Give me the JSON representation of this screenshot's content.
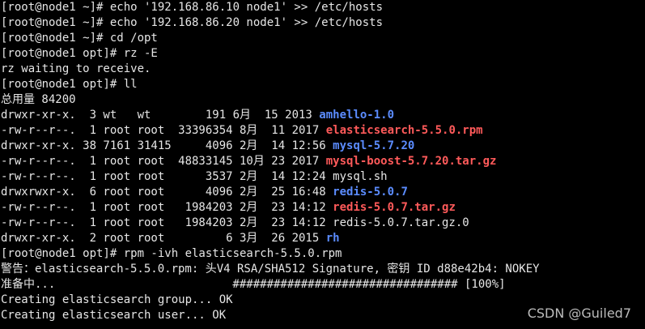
{
  "terminal": {
    "lines": [
      [
        {
          "text": "[root@node1 ~]# echo '192.168.86.10 node1' >> /etc/hosts",
          "style": "normal"
        }
      ],
      [
        {
          "text": "[root@node1 ~]# echo '192.168.86.20 node1' >> /etc/hosts",
          "style": "normal"
        }
      ],
      [
        {
          "text": "[root@node1 ~]# cd /opt",
          "style": "normal"
        }
      ],
      [
        {
          "text": "[root@node1 opt]# rz -E",
          "style": "normal"
        }
      ],
      [
        {
          "text": "rz waiting to receive.",
          "style": "normal"
        }
      ],
      [
        {
          "text": "[root@node1 opt]# ll",
          "style": "normal"
        }
      ],
      [
        {
          "text": "总用量 84200",
          "style": "normal"
        }
      ],
      [
        {
          "text": "drwxr-xr-x.  3 wt   wt        191 6月  15 2013 ",
          "style": "normal"
        },
        {
          "text": "amhello-1.0",
          "style": "blue"
        }
      ],
      [
        {
          "text": "-rw-r--r--.  1 root root  33396354 8月  11 2017 ",
          "style": "normal"
        },
        {
          "text": "elasticsearch-5.5.0.rpm",
          "style": "red"
        }
      ],
      [
        {
          "text": "drwxr-xr-x. 38 7161 31415     4096 2月  14 12:56 ",
          "style": "normal"
        },
        {
          "text": "mysql-5.7.20",
          "style": "blue"
        }
      ],
      [
        {
          "text": "-rw-r--r--.  1 root root  48833145 10月 23 2017 ",
          "style": "normal"
        },
        {
          "text": "mysql-boost-5.7.20.tar.gz",
          "style": "red"
        }
      ],
      [
        {
          "text": "-rw-r--r--.  1 root root      3537 2月  14 12:24 mysql.sh",
          "style": "normal"
        }
      ],
      [
        {
          "text": "drwxrwxr-x.  6 root root      4096 2月  25 16:48 ",
          "style": "normal"
        },
        {
          "text": "redis-5.0.7",
          "style": "blue"
        }
      ],
      [
        {
          "text": "-rw-r--r--.  1 root root   1984203 2月  23 14:12 ",
          "style": "normal"
        },
        {
          "text": "redis-5.0.7.tar.gz",
          "style": "red"
        }
      ],
      [
        {
          "text": "-rw-r--r--.  1 root root   1984203 2月  23 14:12 redis-5.0.7.tar.gz.0",
          "style": "normal"
        }
      ],
      [
        {
          "text": "drwxr-xr-x.  2 root root         6 3月  26 2015 ",
          "style": "normal"
        },
        {
          "text": "rh",
          "style": "blue"
        }
      ],
      [
        {
          "text": "[root@node1 opt]# rpm -ivh elasticsearch-5.5.0.rpm",
          "style": "normal"
        }
      ],
      [
        {
          "text": "警告：elasticsearch-5.5.0.rpm: 头V4 RSA/SHA512 Signature, 密钥 ID d88e42b4: NOKEY",
          "style": "normal"
        }
      ],
      [
        {
          "text": "准备中...                          ################################# [100%]",
          "style": "normal"
        }
      ],
      [
        {
          "text": "Creating elasticsearch group... OK",
          "style": "normal"
        }
      ],
      [
        {
          "text": "Creating elasticsearch user... OK",
          "style": "normal"
        }
      ]
    ]
  },
  "watermark": {
    "text": "CSDN @Guiled7"
  },
  "colors": {
    "background": "#000000",
    "foreground": "#e6e6e6",
    "directory": "#5b8cff",
    "archive": "#ff5a5a"
  }
}
